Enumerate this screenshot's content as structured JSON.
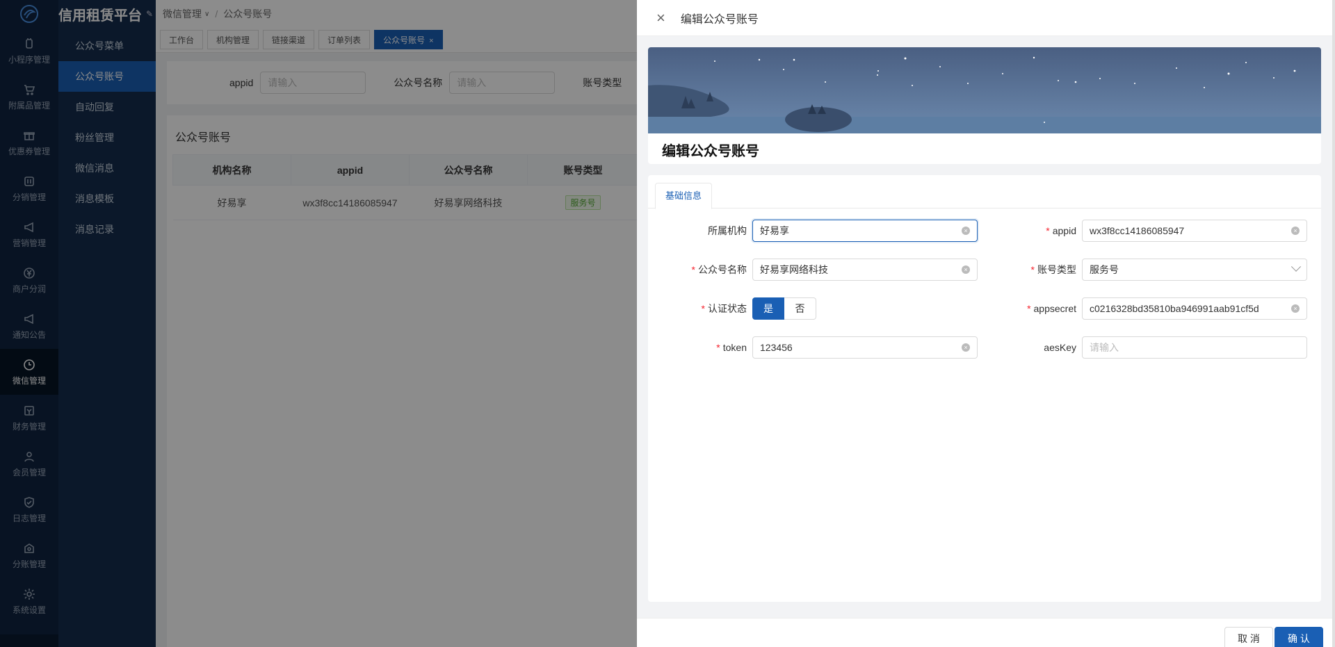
{
  "app": {
    "brand": "信用租赁平台"
  },
  "rail": [
    {
      "label": "小程序管理",
      "icon": "mini-program-icon"
    },
    {
      "label": "附属品管理",
      "icon": "cart-icon"
    },
    {
      "label": "优惠券管理",
      "icon": "gift-icon"
    },
    {
      "label": "分销管理",
      "icon": "sliders-icon"
    },
    {
      "label": "营销管理",
      "icon": "megaphone-icon"
    },
    {
      "label": "商户分润",
      "icon": "yen-icon"
    },
    {
      "label": "通知公告",
      "icon": "announce-icon"
    },
    {
      "label": "微信管理",
      "icon": "wechat-icon",
      "active": true
    },
    {
      "label": "财务管理",
      "icon": "finance-icon"
    },
    {
      "label": "会员管理",
      "icon": "members-icon"
    },
    {
      "label": "日志管理",
      "icon": "shield-icon"
    },
    {
      "label": "分账管理",
      "icon": "split-icon"
    },
    {
      "label": "系统设置",
      "icon": "gear-icon"
    }
  ],
  "submenu": [
    {
      "label": "公众号菜单"
    },
    {
      "label": "公众号账号",
      "active": true
    },
    {
      "label": "自动回复"
    },
    {
      "label": "粉丝管理"
    },
    {
      "label": "微信消息"
    },
    {
      "label": "消息模板"
    },
    {
      "label": "消息记录"
    }
  ],
  "breadcrumb": {
    "parent": "微信管理",
    "current": "公众号账号"
  },
  "tabs": [
    {
      "label": "工作台"
    },
    {
      "label": "机构管理"
    },
    {
      "label": "链接渠道"
    },
    {
      "label": "订单列表"
    },
    {
      "label": "公众号账号",
      "active": true,
      "close": "×"
    }
  ],
  "filter": {
    "appid_label": "appid",
    "appid_placeholder": "请输入",
    "name_label": "公众号名称",
    "name_placeholder": "请输入",
    "type_label": "账号类型"
  },
  "list": {
    "title": "公众号账号",
    "columns": [
      "机构名称",
      "appid",
      "公众号名称",
      "账号类型"
    ],
    "rows": [
      {
        "org": "好易享",
        "appid": "wx3f8cc14186085947",
        "name": "好易享网络科技",
        "type": "服务号"
      }
    ]
  },
  "drawer": {
    "header_title": "编辑公众号账号",
    "close_icon": "×",
    "banner_title": "编辑公众号账号",
    "tab": "基础信息",
    "fields": {
      "org_label": "所属机构",
      "org_value": "好易享",
      "appid_label": "appid",
      "appid_value": "wx3f8cc14186085947",
      "name_label": "公众号名称",
      "name_value": "好易享网络科技",
      "type_label": "账号类型",
      "type_value": "服务号",
      "verify_label": "认证状态",
      "verify_yes": "是",
      "verify_no": "否",
      "secret_label": "appsecret",
      "secret_value": "c0216328bd35810ba946991aab91cf5d",
      "token_label": "token",
      "token_value": "123456",
      "aes_label": "aesKey",
      "aes_placeholder": "请输入"
    },
    "cancel": "取 消",
    "confirm": "确 认"
  },
  "colors": {
    "primary": "#1a5fb4",
    "rail": "#0f2440",
    "submenu": "#152d4d",
    "required": "#f5222d"
  }
}
